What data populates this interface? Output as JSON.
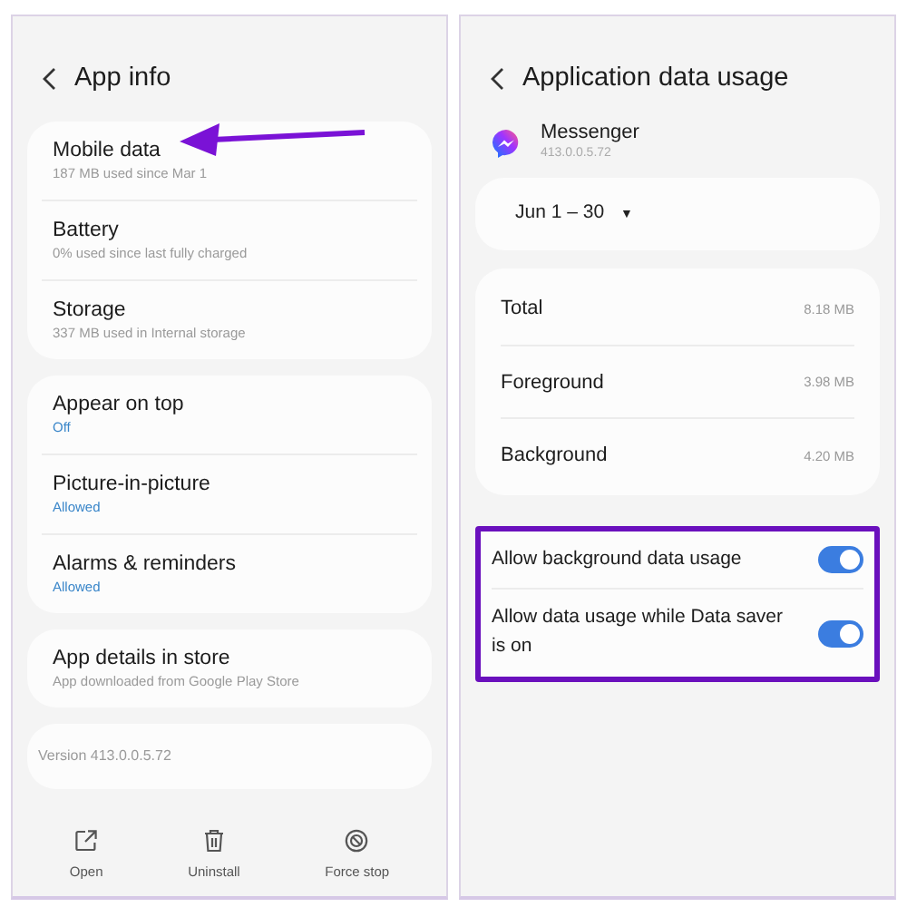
{
  "left_screen": {
    "title": "App info",
    "groups": [
      {
        "items": [
          {
            "title": "Mobile data",
            "subtitle": "187 MB used since Mar 1",
            "kind": "detail",
            "highlighted": true
          },
          {
            "title": "Battery",
            "subtitle": "0% used since last fully charged",
            "kind": "detail",
            "highlighted": false
          },
          {
            "title": "Storage",
            "subtitle": "337 MB used in Internal storage",
            "kind": "detail",
            "highlighted": false
          }
        ]
      },
      {
        "items": [
          {
            "title": "Appear on top",
            "subtitle": "Off",
            "kind": "status",
            "highlighted": false
          },
          {
            "title": "Picture-in-picture",
            "subtitle": "Allowed",
            "kind": "status",
            "highlighted": false
          },
          {
            "title": "Alarms & reminders",
            "subtitle": "Allowed",
            "kind": "status",
            "highlighted": false
          }
        ]
      },
      {
        "items": [
          {
            "title": "App details in store",
            "subtitle": "App downloaded from Google Play Store",
            "kind": "detail",
            "highlighted": false
          }
        ]
      }
    ],
    "version": "Version 413.0.0.5.72",
    "actions": [
      {
        "label": "Open",
        "kind": "open"
      },
      {
        "label": "Uninstall",
        "kind": "trash"
      },
      {
        "label": "Force stop",
        "kind": "stop"
      }
    ]
  },
  "right_screen": {
    "title": "Application data usage",
    "app": {
      "name": "Messenger",
      "version": "413.0.0.5.72"
    },
    "date_range": "Jun 1 – 30",
    "date_caret": "▼",
    "stats": [
      {
        "label": "Total",
        "value": "8.18 MB"
      },
      {
        "label": "Foreground",
        "value": "3.98 MB"
      },
      {
        "label": "Background",
        "value": "4.20 MB"
      }
    ],
    "toggles_highlighted": true,
    "toggles": [
      {
        "label": "Allow background data usage",
        "on": true
      },
      {
        "label": "Allow data usage while Data saver is on",
        "on": true
      }
    ]
  }
}
